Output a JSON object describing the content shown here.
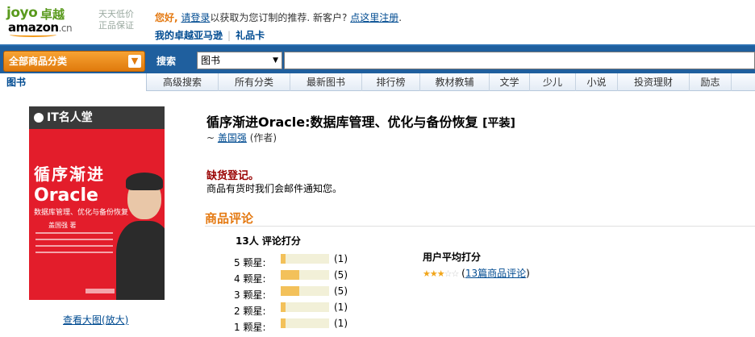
{
  "logo": {
    "joyo": "joyo",
    "zhuoyue": "卓越",
    "amazon": "amazon",
    "cn": ".cn",
    "slogan": "天天低价 正品保证"
  },
  "header": {
    "greeting": "您好,",
    "login_link": "请登录",
    "greeting_mid": "以获取为您订制的推荐. 新客户?",
    "register_link": "点这里注册",
    "greeting_end": ".",
    "my_account": "我的卓越亚马逊",
    "gift_card": "礼品卡"
  },
  "searchbar": {
    "category_button": "全部商品分类",
    "search_label": "搜索",
    "search_scope": "图书",
    "search_value": ""
  },
  "subnav": {
    "current": "图书",
    "items": [
      "高级搜索",
      "所有分类",
      "最新图书",
      "排行榜",
      "教材教辅",
      "文学",
      "少儿",
      "小说",
      "投资理财",
      "励志"
    ]
  },
  "cover": {
    "series": "IT名人堂",
    "handwritten": "循序渐进",
    "big": "Oracle",
    "subtitle": "数据库管理、优化与备份恢复",
    "author_line": "盖国强 著"
  },
  "product": {
    "title": "循序渐进Oracle:数据库管理、优化与备份恢复",
    "binding": "[平装]",
    "byline_prefix": "~",
    "author": "盖国强",
    "author_role": "(作者)",
    "stock_status": "缺货登记。",
    "stock_notice": "商品有货时我们会邮件通知您。",
    "view_large": "查看大图(放大)"
  },
  "reviews": {
    "heading": "商品评论",
    "count_label": "13人 评论打分",
    "histogram": [
      {
        "label": "5 颗星:",
        "count": "(1)",
        "value": 1
      },
      {
        "label": "4 颗星:",
        "count": "(5)",
        "value": 5
      },
      {
        "label": "3 颗星:",
        "count": "(5)",
        "value": 5
      },
      {
        "label": "2 颗星:",
        "count": "(1)",
        "value": 1
      },
      {
        "label": "1 颗星:",
        "count": "(1)",
        "value": 1
      }
    ],
    "histogram_max": 13,
    "avg_heading": "用户平均打分",
    "avg_stars": 3,
    "avg_stars_max": 5,
    "paren_open": "(",
    "review_link": "13篇商品评论",
    "paren_close": ")"
  },
  "colors": {
    "brand_orange": "#e47911",
    "nav_blue": "#1f5f9e",
    "link": "#004b91",
    "out_of_stock": "#990000"
  }
}
